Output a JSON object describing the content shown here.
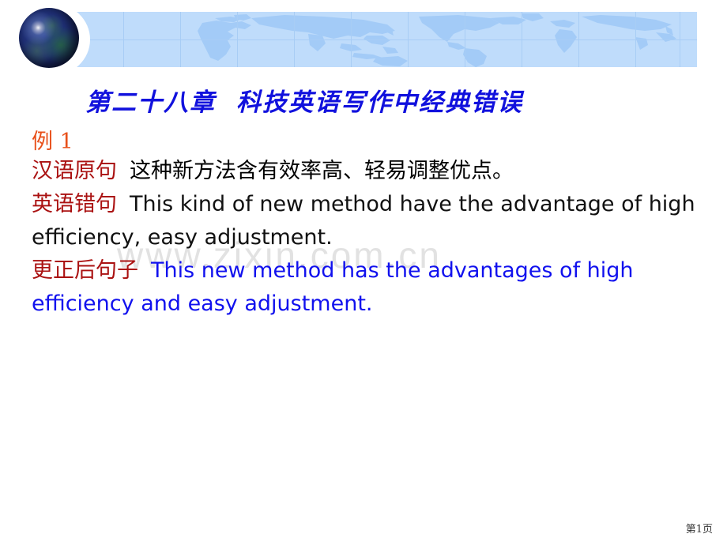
{
  "slide": {
    "title_part1": "第二十八章",
    "title_part2": "科技英语写作中经典错误",
    "watermark": "www.zixin.com.cn",
    "page_number": "第1页",
    "colors": {
      "title_blue": "#1111dd",
      "example_orange": "#e8501a",
      "label_red": "#aa1111",
      "body_black": "#111111",
      "corrected_blue": "#1111ee",
      "banner_blue": "#bfdcfb",
      "banner_grid": "#a8cdf5",
      "watermark_gray": "#e2e2e2"
    }
  },
  "header": {
    "globe_icon": "globe-earth-icon",
    "banner_icon": "world-map-banner"
  },
  "content": {
    "example_number": "例 1",
    "rows": [
      {
        "label": "汉语原句",
        "text": "这种新方法含有效率高、轻易调整优点。"
      },
      {
        "label": "英语错句",
        "text": "This kind of new method have the advantage of high efficiency, easy adjustment."
      },
      {
        "label": "更正后句子",
        "text": "This new method has the advantages of high efficiency and easy adjustment."
      }
    ]
  }
}
